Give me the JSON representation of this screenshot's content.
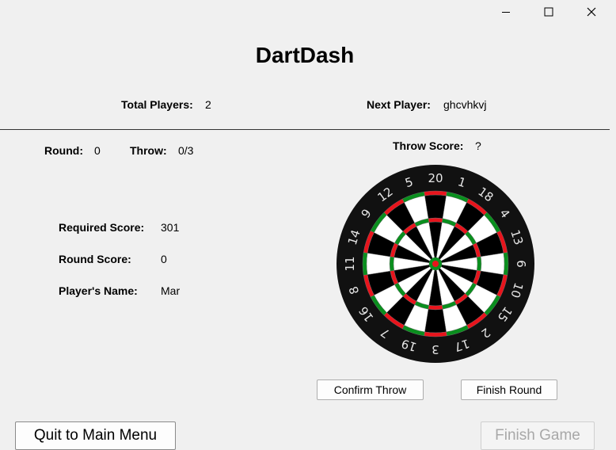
{
  "app": {
    "title": "DartDash"
  },
  "window_controls": [
    "minimize-icon",
    "maximize-icon",
    "close-icon"
  ],
  "header": {
    "total_players_label": "Total Players:",
    "total_players_value": "2",
    "next_player_label": "Next Player:",
    "next_player_value": "ghcvhkvj"
  },
  "round_info": {
    "round_label": "Round:",
    "round_value": "0",
    "throw_label": "Throw:",
    "throw_value": "0/3",
    "throw_score_label": "Throw Score:",
    "throw_score_value": "?"
  },
  "player_info": {
    "required_score_label": "Required Score:",
    "required_score_value": "301",
    "round_score_label": "Round Score:",
    "round_score_value": "0",
    "players_name_label": "Player's Name:",
    "players_name_value": "Mar"
  },
  "dartboard": {
    "numbers": [
      "20",
      "1",
      "18",
      "4",
      "13",
      "6",
      "10",
      "15",
      "2",
      "17",
      "3",
      "19",
      "7",
      "16",
      "8",
      "11",
      "14",
      "9",
      "12",
      "5"
    ],
    "colors": {
      "black": "#000000",
      "white": "#ffffff",
      "red": "#e8141c",
      "green": "#0a8f1e",
      "rim": "#111111",
      "number_text": "#e6e6e6"
    }
  },
  "buttons": {
    "confirm_throw": "Confirm Throw",
    "finish_round": "Finish Round",
    "quit_to_main_menu": "Quit to Main Menu",
    "finish_game": "Finish Game"
  }
}
